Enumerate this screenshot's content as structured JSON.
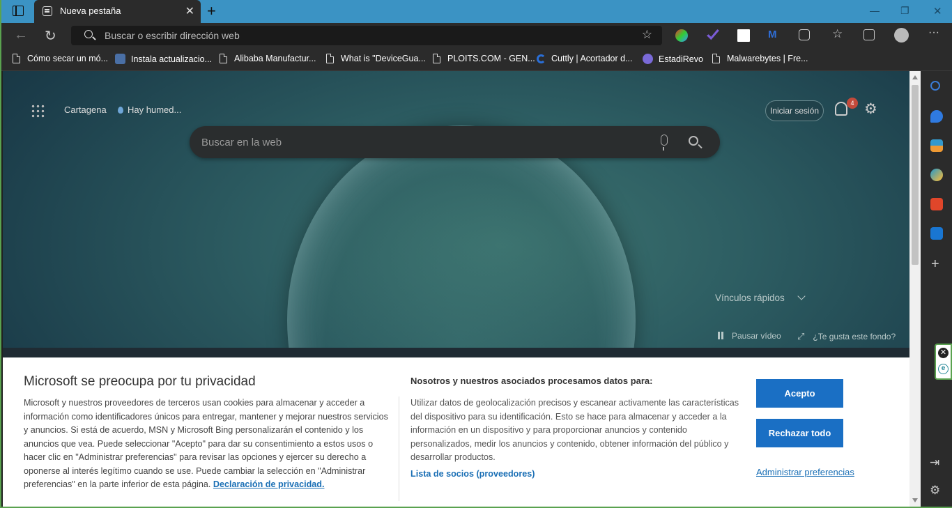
{
  "browser": {
    "tab_title": "Nueva pestaña",
    "address_placeholder": "Buscar o escribir dirección web"
  },
  "bookmarks": [
    {
      "label": "Cómo secar un mó...",
      "icon": "document-icon"
    },
    {
      "label": "Instala actualizacio...",
      "icon": "site-favicon-icon"
    },
    {
      "label": "Alibaba Manufactur...",
      "icon": "document-icon"
    },
    {
      "label": "What is \"DeviceGua...",
      "icon": "document-icon"
    },
    {
      "label": "PLOITS.COM - GEN...",
      "icon": "document-icon"
    },
    {
      "label": "Cuttly | Acortador d...",
      "icon": "cuttly-icon"
    },
    {
      "label": "EstadiRevo",
      "icon": "gear-favicon-icon"
    },
    {
      "label": "Malwarebytes | Fre...",
      "icon": "document-icon"
    }
  ],
  "newtab": {
    "city": "Cartagena",
    "weather": "Hay humed...",
    "signin": "Iniciar sesión",
    "notification_count": "4",
    "search_placeholder": "Buscar en la web",
    "quick_links": "Vínculos rápidos",
    "pause_video": "Pausar vídeo",
    "like_background": "¿Te gusta este fondo?"
  },
  "privacy": {
    "title": "Microsoft se preocupa por tu privacidad",
    "body": "Microsoft y nuestros proveedores de terceros usan cookies para almacenar y acceder a información como identificadores únicos para entregar, mantener y mejorar nuestros servicios y anuncios. Si está de acuerdo, MSN y Microsoft Bing personalizarán el contenido y los anuncios que vea. Puede seleccionar \"Acepto\" para dar su consentimiento a estos usos o hacer clic en \"Administrar preferencias\" para revisar las opciones y ejercer su derecho a oponerse al interés legítimo cuando se use.  Puede cambiar la selección en \"Administrar preferencias\" en la parte inferior de esta página.",
    "privacy_link": "Declaración de privacidad.",
    "heading2": "Nosotros y nuestros asociados procesamos datos para:",
    "body2": "Utilizar datos de geolocalización precisos y escanear activamente las características del dispositivo para su identificación. Esto se hace para almacenar y acceder a la información en un dispositivo y para proporcionar anuncios y contenido personalizados, medir los anuncios y contenido, obtener información del público y desarrollar productos.",
    "partners_link": "Lista de socios (proveedores)",
    "accept": "Acepto",
    "reject": "Rechazar todo",
    "manage": "Administrar preferencias"
  },
  "colors": {
    "titlebar": "#3b93c4",
    "chrome": "#2b2b2b",
    "accent_button": "#1a6fc4",
    "link": "#1a6fb5",
    "highlight_border": "#5aa24f"
  }
}
